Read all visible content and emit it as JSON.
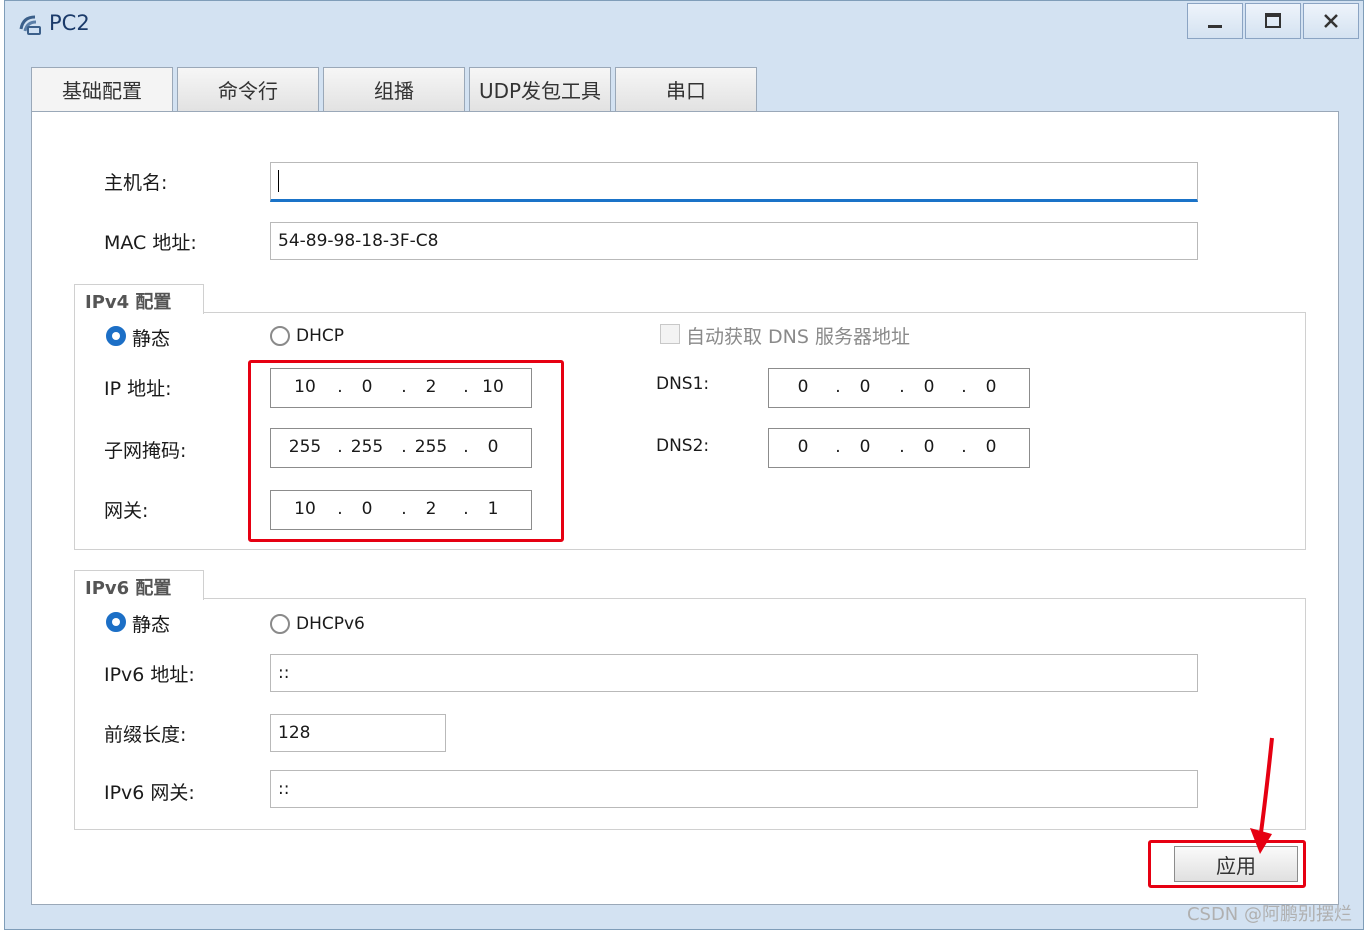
{
  "window": {
    "title": "PC2",
    "controls": [
      "minimize",
      "maximize",
      "close"
    ]
  },
  "tabs": [
    {
      "label": "基础配置",
      "active": true
    },
    {
      "label": "命令行",
      "active": false
    },
    {
      "label": "组播",
      "active": false
    },
    {
      "label": "UDP发包工具",
      "active": false
    },
    {
      "label": "串口",
      "active": false
    }
  ],
  "hostname": {
    "label": "主机名:",
    "value": ""
  },
  "mac": {
    "label": "MAC 地址:",
    "value": "54-89-98-18-3F-C8"
  },
  "ipv4": {
    "group_title": "IPv4 配置",
    "mode_static": "静态",
    "mode_dhcp": "DHCP",
    "selected_mode": "static",
    "auto_dns_label": "自动获取 DNS 服务器地址",
    "ip_label": "IP 地址:",
    "ip": [
      "10",
      "0",
      "2",
      "10"
    ],
    "mask_label": "子网掩码:",
    "mask": [
      "255",
      "255",
      "255",
      "0"
    ],
    "gateway_label": "网关:",
    "gateway": [
      "10",
      "0",
      "2",
      "1"
    ],
    "dns1_label": "DNS1:",
    "dns1": [
      "0",
      "0",
      "0",
      "0"
    ],
    "dns2_label": "DNS2:",
    "dns2": [
      "0",
      "0",
      "0",
      "0"
    ]
  },
  "ipv6": {
    "group_title": "IPv6 配置",
    "mode_static": "静态",
    "mode_dhcp": "DHCPv6",
    "selected_mode": "static",
    "addr_label": "IPv6 地址:",
    "addr": "::",
    "prefix_label": "前缀长度:",
    "prefix": "128",
    "gateway_label": "IPv6 网关:",
    "gateway": "::"
  },
  "apply_label": "应用",
  "watermark": "CSDN @阿鹏别摆烂",
  "colors": {
    "highlight": "#e60012",
    "accent": "#1c6fc6"
  }
}
